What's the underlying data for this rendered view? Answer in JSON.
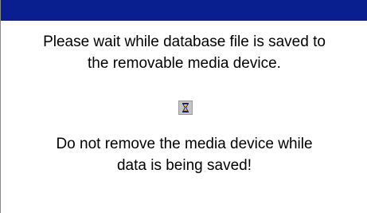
{
  "dialog": {
    "message_line1": "Please wait while database file is saved to",
    "message_line2": "the removable media device.",
    "warning_line1": "Do not remove the media device while",
    "warning_line2": "data is being saved!",
    "icon": "hourglass-icon"
  },
  "colors": {
    "titlebar": "#0a1f8f",
    "background": "#ffffff",
    "text": "#000000"
  }
}
